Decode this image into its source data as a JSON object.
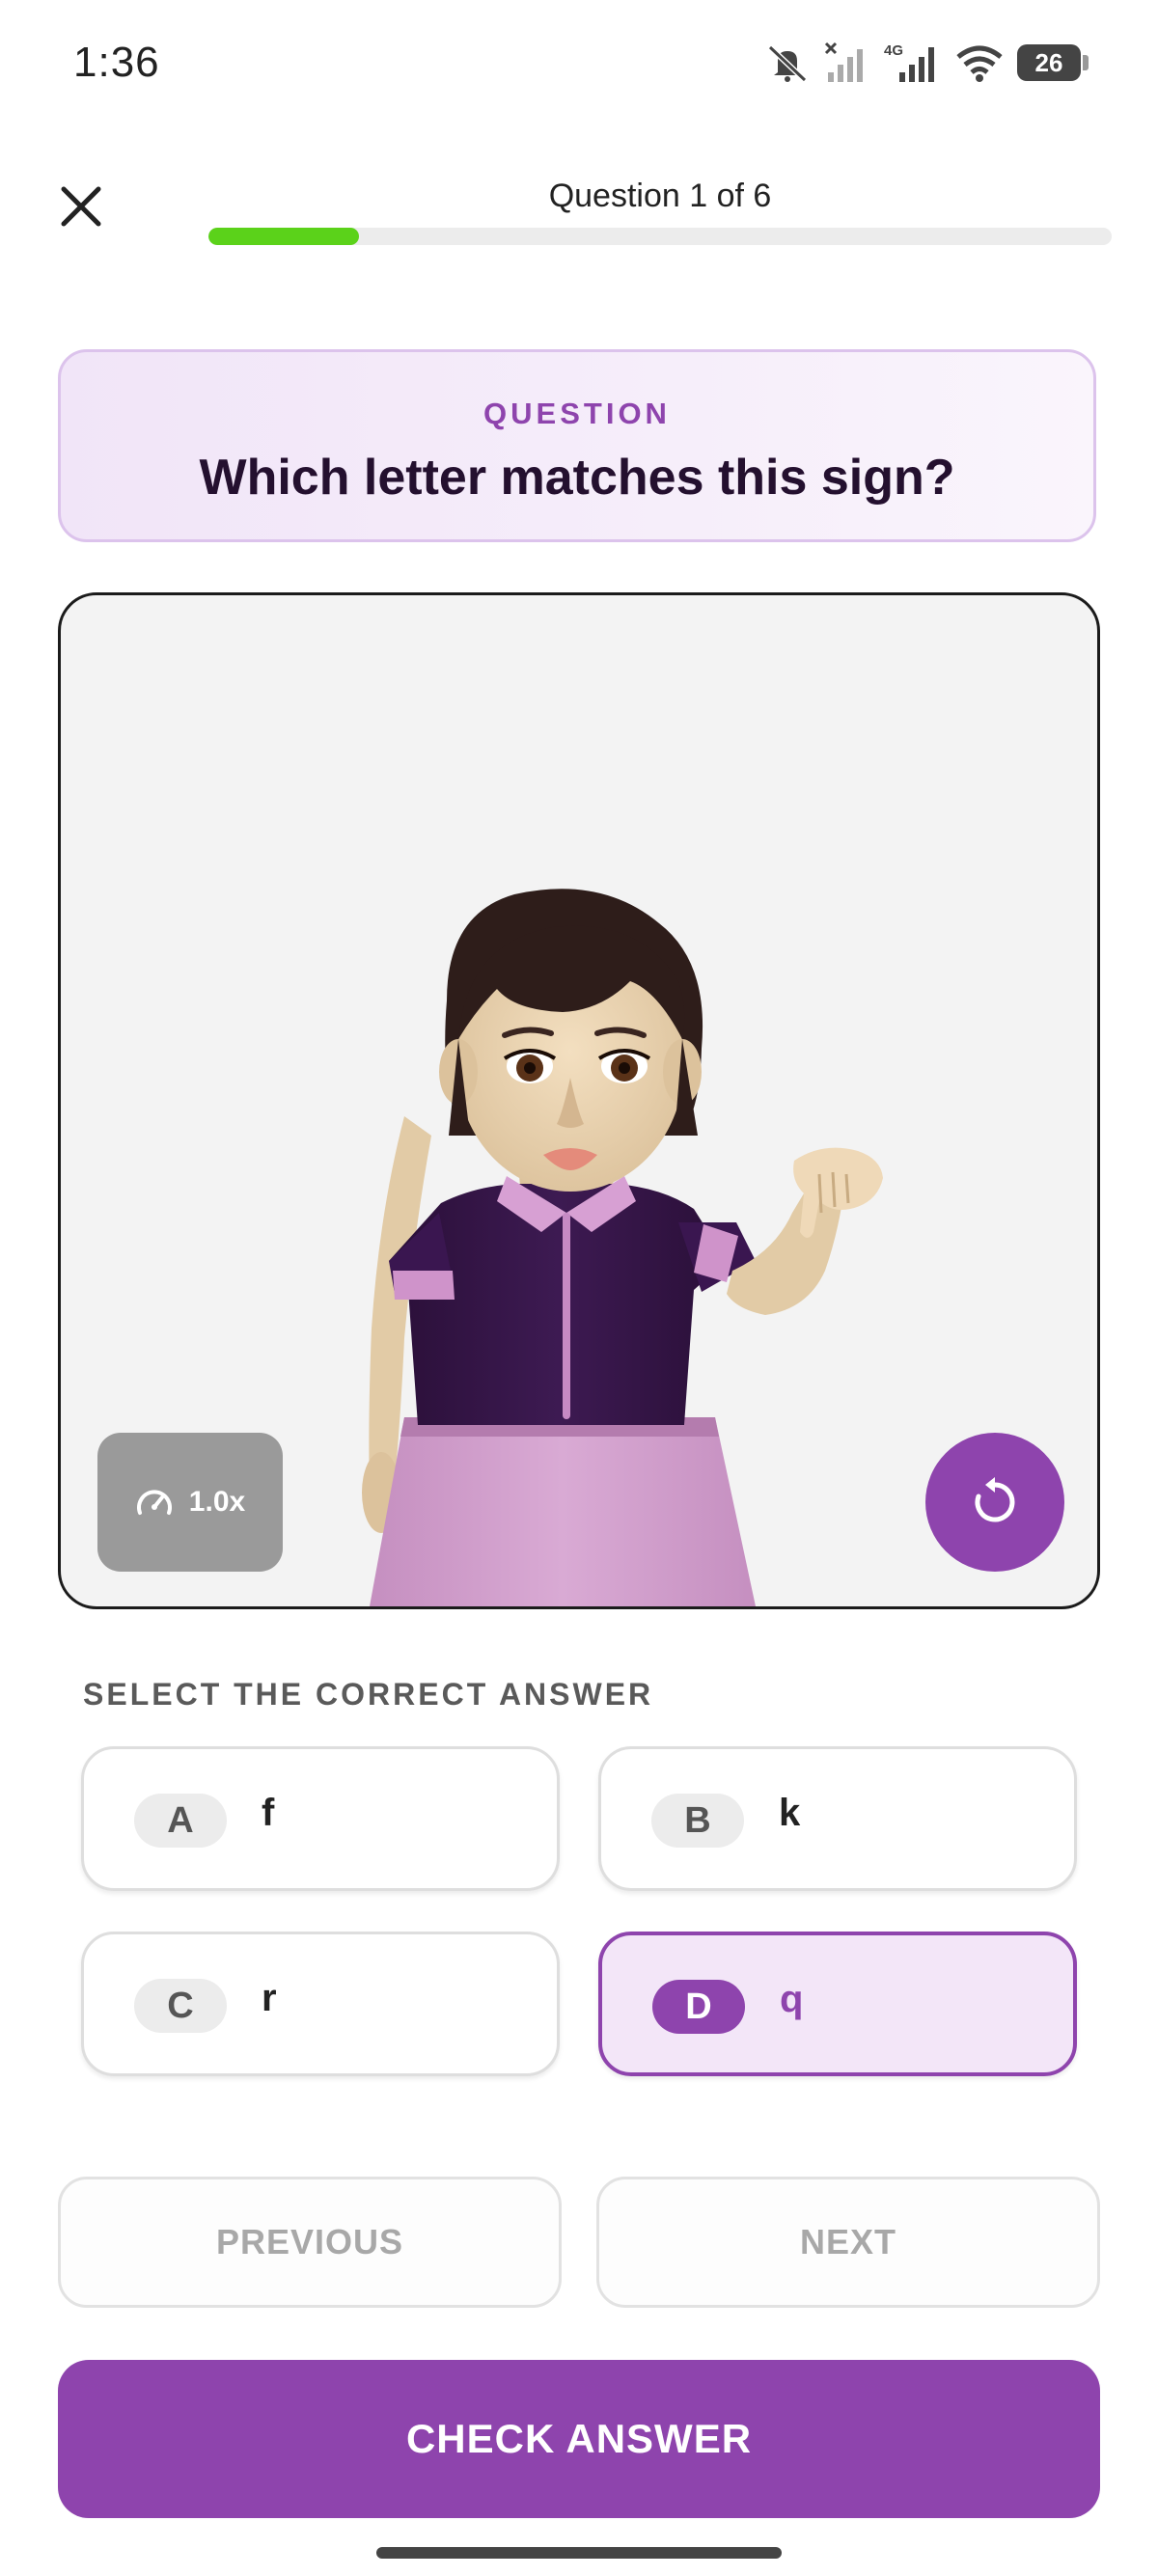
{
  "status_bar": {
    "time": "1:36",
    "battery_level": "26",
    "icons": [
      "mute-icon",
      "signal-off-icon",
      "signal-4g-icon",
      "wifi-icon",
      "battery-icon"
    ]
  },
  "header": {
    "question_counter": "Question 1 of 6",
    "progress": 0.1667,
    "progress_color": "#5bd21a",
    "close_icon": "close-icon"
  },
  "question": {
    "eyebrow": "QUESTION",
    "text": "Which letter matches this sign?"
  },
  "video": {
    "speed_label": "1.0x",
    "speed_icon": "speedometer-icon",
    "replay_icon": "replay-icon"
  },
  "answers": {
    "label": "SELECT THE CORRECT ANSWER",
    "selected": "D",
    "options": [
      {
        "letter": "A",
        "text": "f"
      },
      {
        "letter": "B",
        "text": "k"
      },
      {
        "letter": "C",
        "text": "r"
      },
      {
        "letter": "D",
        "text": "q"
      }
    ]
  },
  "navigation": {
    "previous_label": "PREVIOUS",
    "next_label": "NEXT",
    "check_label": "CHECK ANSWER"
  },
  "colors": {
    "accent": "#8e44ad",
    "progress": "#5bd21a",
    "selected_bg": "#f3e6f8"
  }
}
